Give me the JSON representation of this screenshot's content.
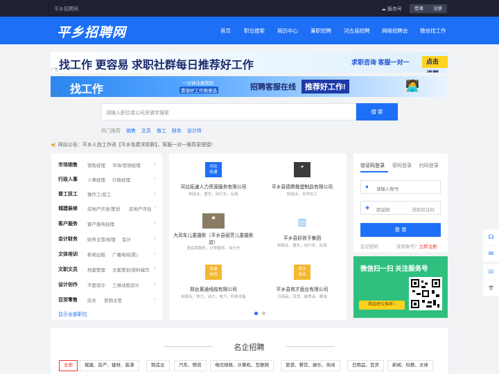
{
  "topbar": {
    "site_name": "平乡招聘网",
    "service_label": "服务号",
    "login": "登录",
    "register": "注册"
  },
  "header": {
    "logo": "平乡招聘网",
    "nav": [
      "首页",
      "职位搜索",
      "简历中心",
      "兼职招聘",
      "河古庙招聘",
      "网络招聘会",
      "微信找工作"
    ]
  },
  "banners": {
    "b1": {
      "main": "找工作 更容易 求职社群每日推荐好工作",
      "consult": "求职咨询 客服一对一",
      "cta": "点击进群",
      "ad": "广告"
    },
    "b2": {
      "main": "找工作",
      "sub1": "一分钟注册简历",
      "sub2": "靠谱好工作随意选",
      "service": "招聘客服在线",
      "recommend": "推荐好工作!",
      "ad": "广告"
    }
  },
  "search": {
    "placeholder": "请输入职位或公司关键字搜索",
    "button": "搜 索"
  },
  "hot": {
    "label": "热门推荐",
    "keywords": [
      "销售",
      "文员",
      "普工",
      "财务",
      "设计师"
    ]
  },
  "notice": "网站公告：平乡人找工作进【平乡免费求职群】，客服一对一推荐更便捷！",
  "categories": {
    "items": [
      {
        "title": "市场销售",
        "s1": "销售经理",
        "s2": "市场/营销经理"
      },
      {
        "title": "行政人事",
        "s1": "人事经理",
        "s2": "行政经理"
      },
      {
        "title": "普工技工",
        "s1": "操作工/普工",
        "s2": ""
      },
      {
        "title": "城建装修",
        "s1": "房地产开发/策划",
        "s2": "房地产评估"
      },
      {
        "title": "客户服务",
        "s1": "客户服务经理",
        "s2": ""
      },
      {
        "title": "会计财务",
        "s1": "财务主管/经理",
        "s2": "会计"
      },
      {
        "title": "文体培训",
        "s1": "新闻出版",
        "s2": "广播电视(影)"
      },
      {
        "title": "文职文员",
        "s1": "档案管理",
        "s2": "文案策划/资料编写"
      },
      {
        "title": "设计创作",
        "s1": "平面设计",
        "s2": "三维动画设计"
      },
      {
        "title": "百货零售",
        "s1": "店长",
        "s2": "营销主管"
      }
    ],
    "more": "显示全部职位"
  },
  "companies": [
    {
      "logo": "河北\n拓通",
      "name": "河北拓速人力资源服务有限公司",
      "tags": "制造业，童车，自行车，玩具"
    },
    {
      "logo": "",
      "name": "平乡县德鼎橡塑制品有限公司",
      "tags": "制造业，化学化工"
    },
    {
      "logo": "",
      "name": "大风车儿童摄影（平乡县丽芳儿童摄影店）",
      "tags": "居民和服务，日常服务，自行车"
    },
    {
      "logo": "",
      "name": "平乡县好孩子集团",
      "tags": "制造业，童车，自行车，玩具"
    },
    {
      "logo": "系通\n物流",
      "name": "邢台莱通线缆有限公司",
      "tags": "制造业，热力，动力，电力，机电设备"
    },
    {
      "logo": "育才\n商业",
      "name": "平乡县育才面业有限公司",
      "tags": "日用品，百货，副食品，粮油"
    }
  ],
  "login": {
    "tabs": [
      "验证码登录",
      "密码登录",
      "扫码登录"
    ],
    "phone_placeholder": "请输入账号",
    "code_placeholder": "验证码",
    "get_code": "获取验证码",
    "button": "登 录",
    "forgot": "忘记密码",
    "no_account": "没有账号？",
    "register": "立即注册"
  },
  "wechat": {
    "title": "微信扫一扫 关注服务号",
    "button": "精选职位推荐 ›"
  },
  "famous": {
    "title": "名企招聘",
    "tags": [
      "全部",
      "城建、房产、建材、装潢",
      "制造业",
      "汽车、物流",
      "电信邮政、计算机、互联网",
      "旅游、餐饮、娱乐、休闲",
      "日用品、百货",
      "新闻、科教、文体"
    ]
  },
  "colors": {
    "brand": "#1d6ff5",
    "topbar": "#1d2131",
    "wechat": "#2fc07f",
    "accent": "#e33"
  }
}
